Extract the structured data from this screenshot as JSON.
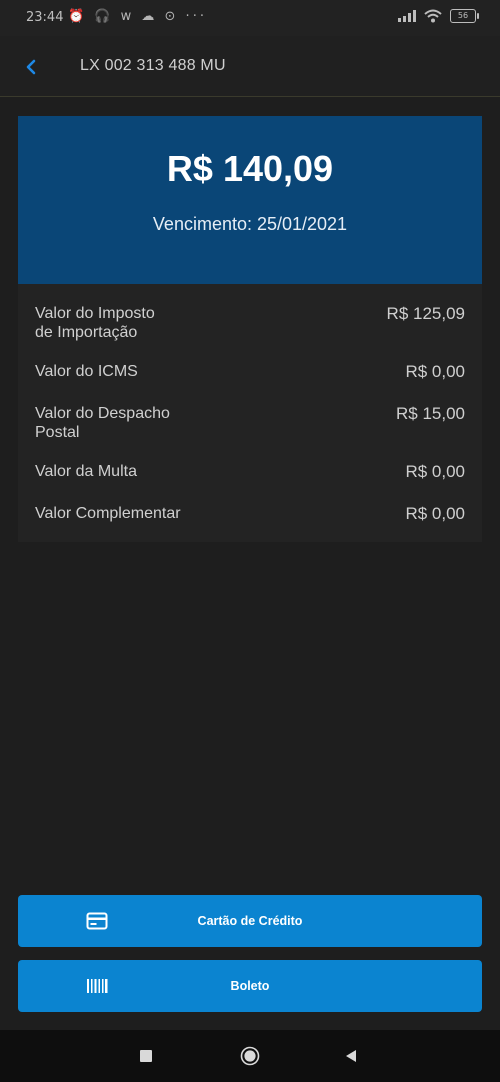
{
  "status_bar": {
    "time": "23:44",
    "notification_icons": "⏰ 🎧 w ☁ ⊙ ···",
    "battery": "56"
  },
  "header": {
    "back_icon": "chevron-left-icon",
    "title": "LX 002 313 488 MU"
  },
  "summary": {
    "amount": "R$ 140,09",
    "due": "Vencimento: 25/01/2021"
  },
  "details": {
    "rows": [
      {
        "label": "Valor do Imposto\nde Importação",
        "value": "R$ 125,09"
      },
      {
        "label": "Valor do ICMS",
        "value": "R$ 0,00"
      },
      {
        "label": "Valor do Despacho\nPostal",
        "value": "R$ 15,00"
      },
      {
        "label": "Valor da Multa",
        "value": "R$ 0,00"
      },
      {
        "label": "Valor Complementar",
        "value": "R$ 0,00"
      }
    ]
  },
  "payment": {
    "credit_card_label": "Cartão de Crédito",
    "credit_card_icon": "credit-card-icon",
    "boleto_label": "Boleto",
    "boleto_icon": "barcode-icon"
  },
  "colors": {
    "background": "#1e1e1e",
    "summary_blue": "#0a4677",
    "button_blue": "#0b84d0",
    "accent": "#1e88e5"
  }
}
